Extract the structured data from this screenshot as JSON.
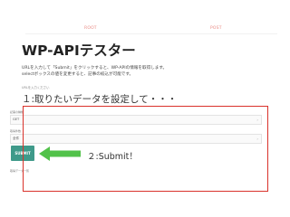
{
  "tabs": {
    "get_label": "ROOT",
    "post_label": "POST"
  },
  "header": {
    "title": "WP-APIテスター"
  },
  "intro": {
    "line1": "URLを入力して「Submit」をクリックすると、WP-APIの情報を取得します。",
    "line2": "selectボックスの値を変更すると、記事の絞込が可能です。"
  },
  "small_note": "URLを入力ください",
  "annotations": {
    "step1": "１:取りたいデータを設定して・・・",
    "step2": "２:Submit！"
  },
  "form": {
    "fields": [
      {
        "label": "記事の種類",
        "value": "GET"
      },
      {
        "label": "取得件数",
        "value": "全件"
      }
    ],
    "submit_label": "SUBMIT",
    "result_label": "取得データ一覧"
  },
  "colors": {
    "accent": "#e98a84",
    "button": "#3f9a8a",
    "annotation": "#d9322b",
    "arrow": "#52c24a"
  }
}
